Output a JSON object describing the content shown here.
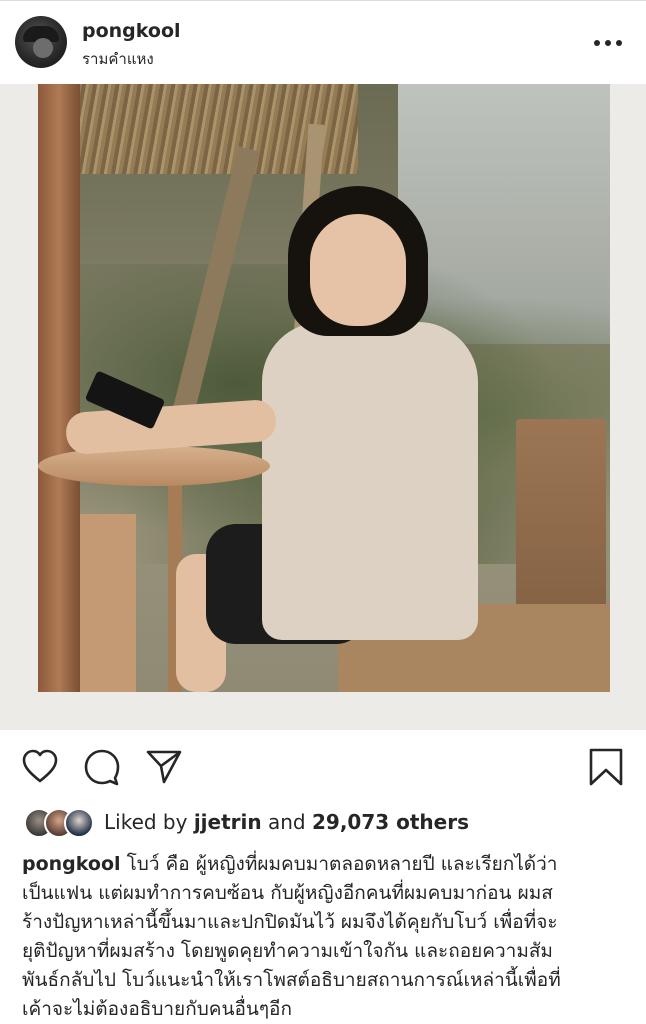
{
  "post": {
    "username": "pongkool",
    "location": "รามคำแหง",
    "more_icon": "ellipsis-icon"
  },
  "actions": {
    "like_icon": "heart-icon",
    "comment_icon": "comment-icon",
    "share_icon": "share-icon",
    "save_icon": "bookmark-icon"
  },
  "likes": {
    "prefix": "Liked by",
    "user": "jjetrin",
    "middle": "and",
    "count": "29,073 others"
  },
  "caption": {
    "username": "pongkool",
    "lines": [
      "โบว์ คือ ผู้หญิงที่ผมคบมาตลอดหลายปี และเรียกได้ว่า",
      "เป็นแฟน แต่ผมทำการคบซ้อน กับผู้หญิงอีกคนที่ผมคบมาก่อน ผมส",
      "ร้างปัญหาเหล่านี้ขึ้นมาและปกปิดมันไว้ ผมจึงได้คุยกับโบว์ เพื่อที่จะ",
      "ยุติปัญหาที่ผมสร้าง โดยพูดคุยทำความเข้าใจกัน และถอยความสัม",
      "พันธ์กลับไป โบว์แนะนำให้เราโพสต์อธิบายสถานการณ์เหล่านี้เพื่อที่",
      "เค้าจะไม่ต้องอธิบายกับคนอื่นๆอีก"
    ]
  },
  "colors": {
    "text": "#262626",
    "divider": "#dbdbdb"
  }
}
